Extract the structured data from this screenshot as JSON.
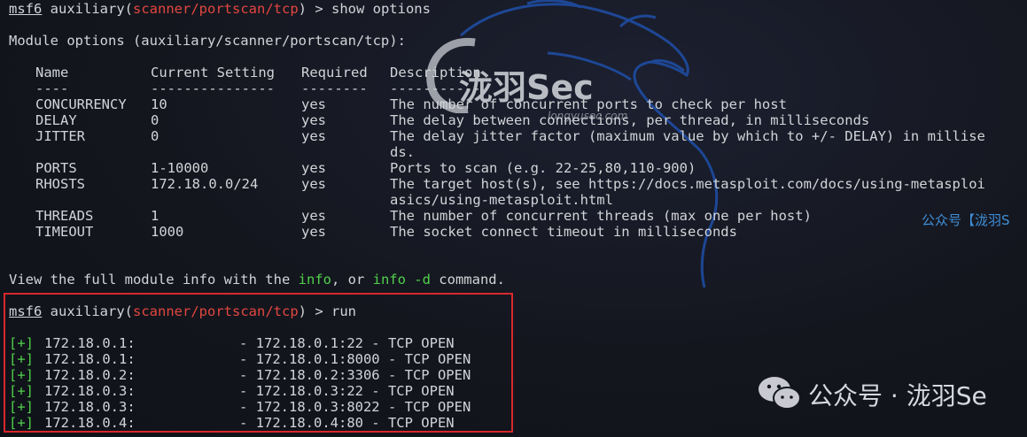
{
  "prompt1": {
    "host": "msf6",
    "module_type": "auxiliary",
    "module_path": "scanner/portscan/tcp",
    "command": "show options"
  },
  "module_options_header": "Module options (auxiliary/scanner/portscan/tcp):",
  "table": {
    "headers": [
      "Name",
      "Current Setting",
      "Required",
      "Description"
    ],
    "separators": [
      "----",
      "---------------",
      "--------",
      "-----------"
    ],
    "rows": [
      {
        "name": "CONCURRENCY",
        "setting": "10",
        "required": "yes",
        "desc": "The number of concurrent ports to check per host"
      },
      {
        "name": "DELAY",
        "setting": "0",
        "required": "yes",
        "desc": "The delay between connections, per thread, in milliseconds"
      },
      {
        "name": "JITTER",
        "setting": "0",
        "required": "yes",
        "desc": "The delay jitter factor (maximum value by which to +/- DELAY) in millise",
        "desc2": "ds."
      },
      {
        "name": "PORTS",
        "setting": "1-10000",
        "required": "yes",
        "desc": "Ports to scan (e.g. 22-25,80,110-900)"
      },
      {
        "name": "RHOSTS",
        "setting": "172.18.0.0/24",
        "required": "yes",
        "desc": "The target host(s), see https://docs.metasploit.com/docs/using-metasploi",
        "desc2": "asics/using-metasploit.html"
      },
      {
        "name": "THREADS",
        "setting": "1",
        "required": "yes",
        "desc": "The number of concurrent threads (max one per host)"
      },
      {
        "name": "TIMEOUT",
        "setting": "1000",
        "required": "yes",
        "desc": "The socket connect timeout in milliseconds"
      }
    ]
  },
  "info_line": {
    "prefix": "View the full module info with the ",
    "cmd1": "info",
    "mid": ", or ",
    "cmd2": "info -d",
    "suffix": " command."
  },
  "prompt2": {
    "host": "msf6",
    "module_type": "auxiliary",
    "module_path": "scanner/portscan/tcp",
    "command": "run"
  },
  "results": [
    {
      "tag": "[+]",
      "host": "172.18.0.1:",
      "result": "- 172.18.0.1:22 - TCP OPEN"
    },
    {
      "tag": "[+]",
      "host": "172.18.0.1:",
      "result": "- 172.18.0.1:8000 - TCP OPEN"
    },
    {
      "tag": "[+]",
      "host": "172.18.0.2:",
      "result": "- 172.18.0.2:3306 - TCP OPEN"
    },
    {
      "tag": "[+]",
      "host": "172.18.0.3:",
      "result": "- 172.18.0.3:22 - TCP OPEN"
    },
    {
      "tag": "[+]",
      "host": "172.18.0.3:",
      "result": "- 172.18.0.3:8022 - TCP OPEN"
    },
    {
      "tag": "[+]",
      "host": "172.18.0.4:",
      "result": "- 172.18.0.4:80 - TCP OPEN"
    }
  ],
  "watermarks": {
    "logo_text": "泷羽Sec",
    "logo_sub": "longyusec.com",
    "side_text": "公众号【泷羽S",
    "bottom_text": "公众号 · 泷羽Se"
  },
  "colors": {
    "background": "#14161e",
    "text": "#d2d4d8",
    "module_red": "#e2473f",
    "info_green": "#4fd14a",
    "highlight_border": "#d8282c",
    "dragon_blue": "#1f4fa8"
  }
}
